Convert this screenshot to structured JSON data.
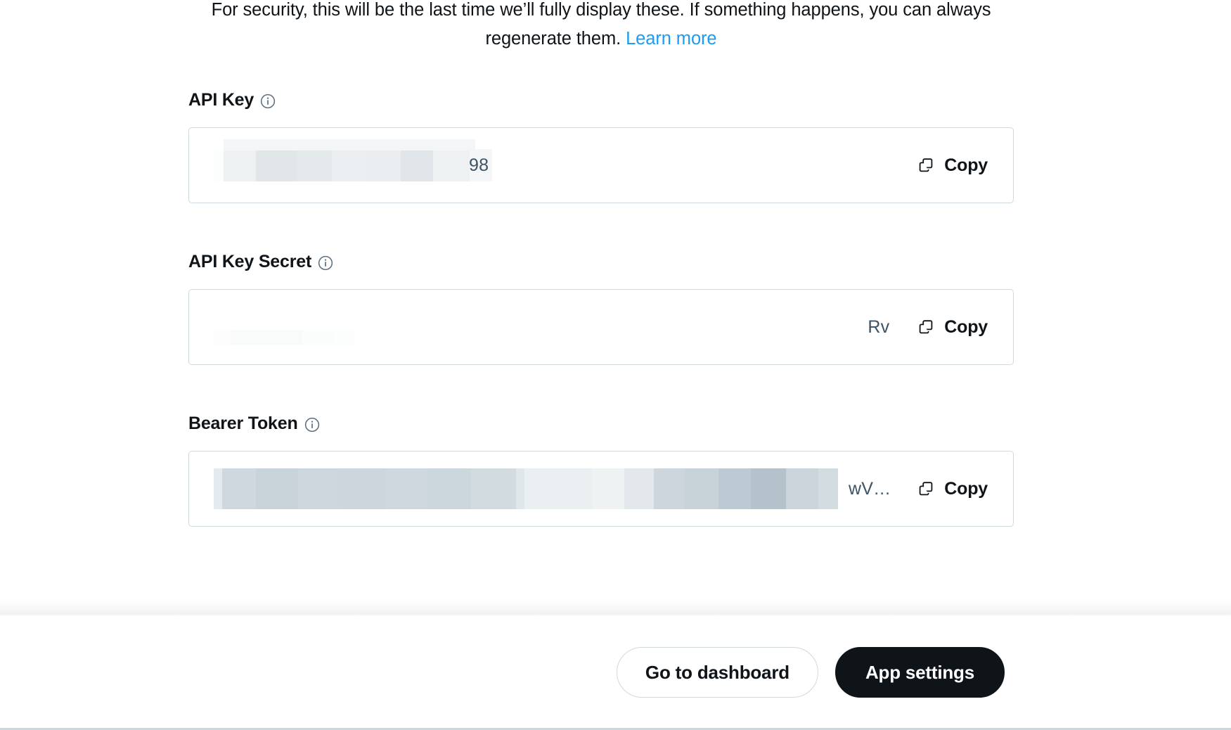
{
  "notice": {
    "text_before_link": "For security, this will be the last time we’ll fully display these. If something happens, you can always regenerate them. ",
    "link_label": "Learn more"
  },
  "fields": [
    {
      "label": "API Key",
      "info_icon": "info-circle-icon",
      "value_visible_tail": "98",
      "redacted": true,
      "copy_label": "Copy",
      "copy_icon": "copy-icon"
    },
    {
      "label": "API Key Secret",
      "info_icon": "info-circle-icon",
      "value_visible_tail": "Rv",
      "redacted": true,
      "copy_label": "Copy",
      "copy_icon": "copy-icon"
    },
    {
      "label": "Bearer Token",
      "info_icon": "info-circle-icon",
      "value_visible_tail": "wV…",
      "redacted": true,
      "copy_label": "Copy",
      "copy_icon": "copy-icon"
    }
  ],
  "footer": {
    "secondary_button": "Go to dashboard",
    "primary_button": "App settings"
  },
  "colors": {
    "link_blue": "#1d9bf0",
    "text_primary": "#0f1419",
    "border": "#cfd9de",
    "primary_button_bg": "#0f1419",
    "value_text": "#3d5466"
  }
}
